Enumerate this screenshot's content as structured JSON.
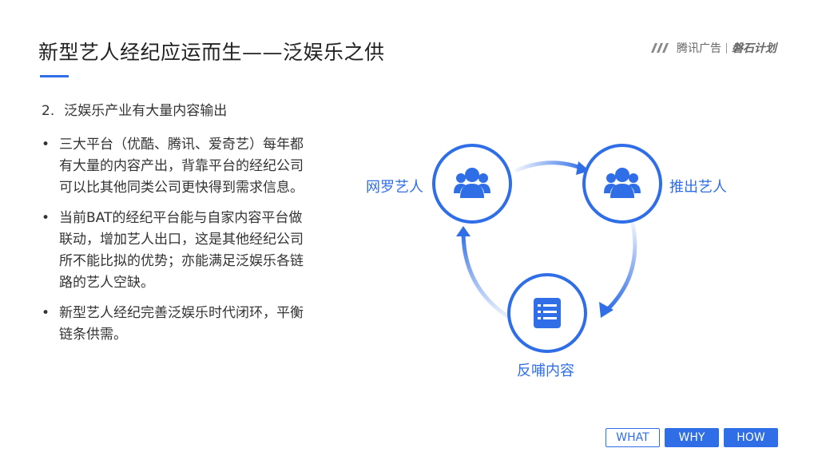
{
  "header": {
    "title": "新型艺人经纪应运而生——泛娱乐之供",
    "logo_brand": "腾讯广告",
    "logo_plan": "磐石计划"
  },
  "subtitle": {
    "number": "2.",
    "text": "泛娱乐产业有大量内容输出"
  },
  "bullets": [
    {
      "text": "三大平台（优酷、腾讯、爱奇艺）每年都有大量的内容产出，背靠平台的经纪公司可以比其他同类公司更快得到需求信息。"
    },
    {
      "text": "当前BAT的经纪平台能与自家内容平台做联动，增加艺人出口，这是其他经纪公司所不能比拟的优势；亦能满足泛娱乐各链路的艺人空缺。"
    },
    {
      "text": "新型艺人经纪完善泛娱乐时代闭环，平衡链条供需。"
    }
  ],
  "diagram": {
    "nodes": [
      {
        "label": "网罗艺人",
        "icon": "users-icon"
      },
      {
        "label": "推出艺人",
        "icon": "users-icon"
      },
      {
        "label": "反哺内容",
        "icon": "document-list-icon"
      }
    ],
    "accent": "#2f6ee6"
  },
  "nav": {
    "items": [
      {
        "label": "WHAT"
      },
      {
        "label": "WHY"
      },
      {
        "label": "HOW"
      }
    ]
  }
}
